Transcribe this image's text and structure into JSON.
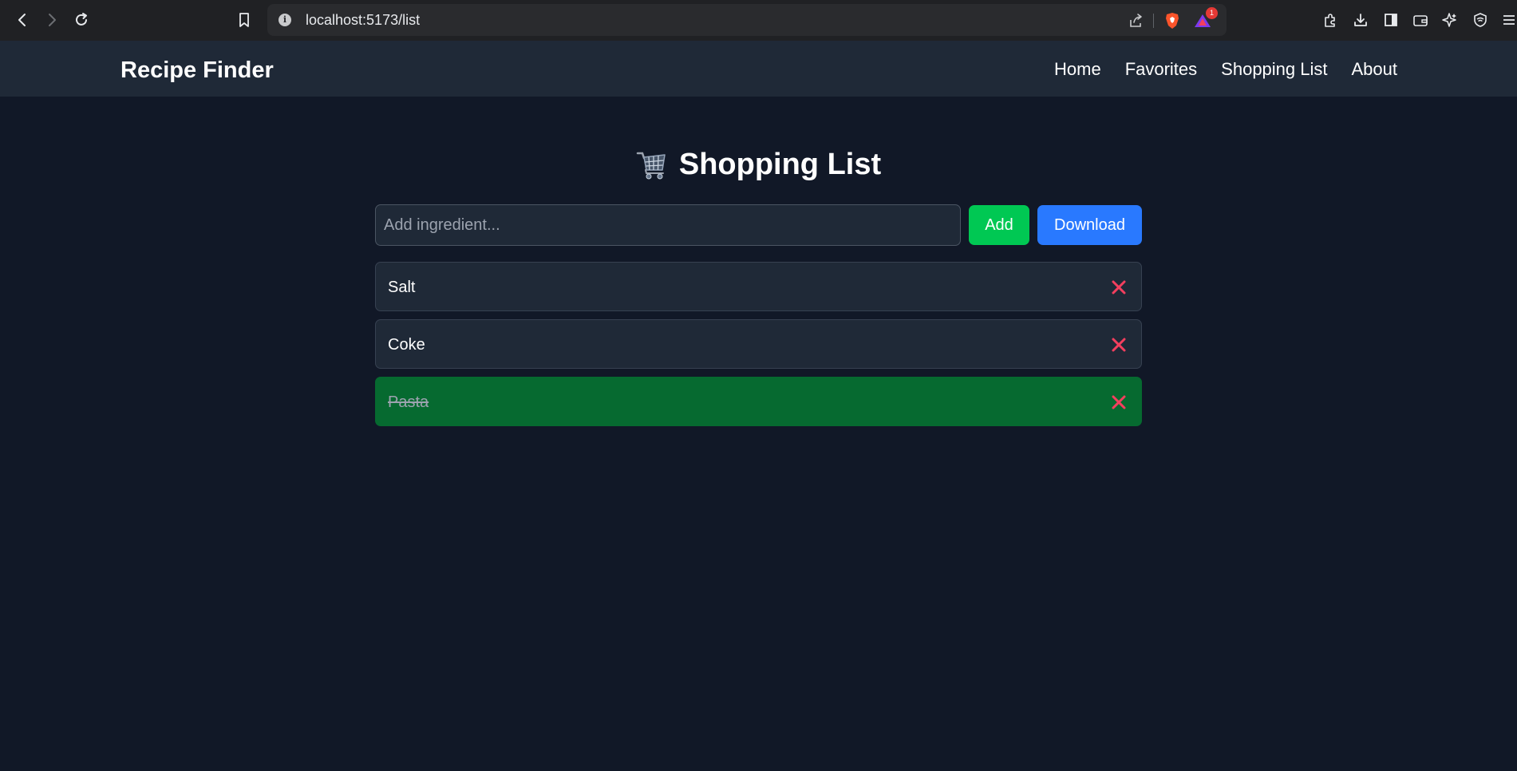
{
  "browser": {
    "url": "localhost:5173/list",
    "badge_count": "1"
  },
  "nav": {
    "brand": "Recipe Finder",
    "links": [
      {
        "label": "Home"
      },
      {
        "label": "Favorites"
      },
      {
        "label": "Shopping List"
      },
      {
        "label": "About"
      }
    ]
  },
  "page": {
    "title": "Shopping List",
    "icon": "shopping-cart-icon",
    "input_placeholder": "Add ingredient...",
    "input_value": "",
    "add_label": "Add",
    "download_label": "Download"
  },
  "items": [
    {
      "label": "Salt",
      "checked": false
    },
    {
      "label": "Coke",
      "checked": false
    },
    {
      "label": "Pasta",
      "checked": true
    }
  ],
  "colors": {
    "background": "#111827",
    "nav_background": "#1f2937",
    "add_button": "#00c853",
    "download_button": "#2979ff",
    "checked_item": "#066a30",
    "remove_icon": "#f43f5e"
  }
}
